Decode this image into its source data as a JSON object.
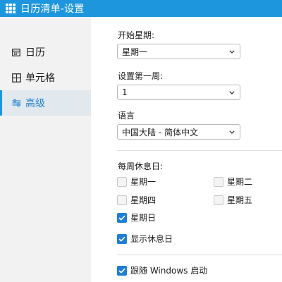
{
  "window": {
    "title": "日历清单-设置"
  },
  "sidebar": {
    "items": [
      {
        "label": "日历",
        "icon": "calendar-icon",
        "active": false
      },
      {
        "label": "单元格",
        "icon": "grid-icon",
        "active": false
      },
      {
        "label": "高级",
        "icon": "sliders-icon",
        "active": true
      }
    ]
  },
  "settings": {
    "week_start": {
      "label": "开始星期:",
      "value": "星期一"
    },
    "first_week": {
      "label": "设置第一周:",
      "value": "1"
    },
    "language": {
      "label": "语言",
      "value": "中国大陆 - 简体中文"
    },
    "rest_days": {
      "label": "每周休息日:",
      "days": [
        {
          "label": "星期一",
          "checked": false
        },
        {
          "label": "星期二",
          "checked": false
        },
        {
          "label": "星期四",
          "checked": false
        },
        {
          "label": "星期五",
          "checked": false
        },
        {
          "label": "星期日",
          "checked": true
        }
      ]
    },
    "show_rest_day": {
      "label": "显示休息日",
      "checked": true
    },
    "autostart": {
      "label": "跟随 Windows 启动",
      "checked": true
    }
  },
  "colors": {
    "accent": "#1e96dd",
    "checkbox": "#1e7fd4"
  }
}
